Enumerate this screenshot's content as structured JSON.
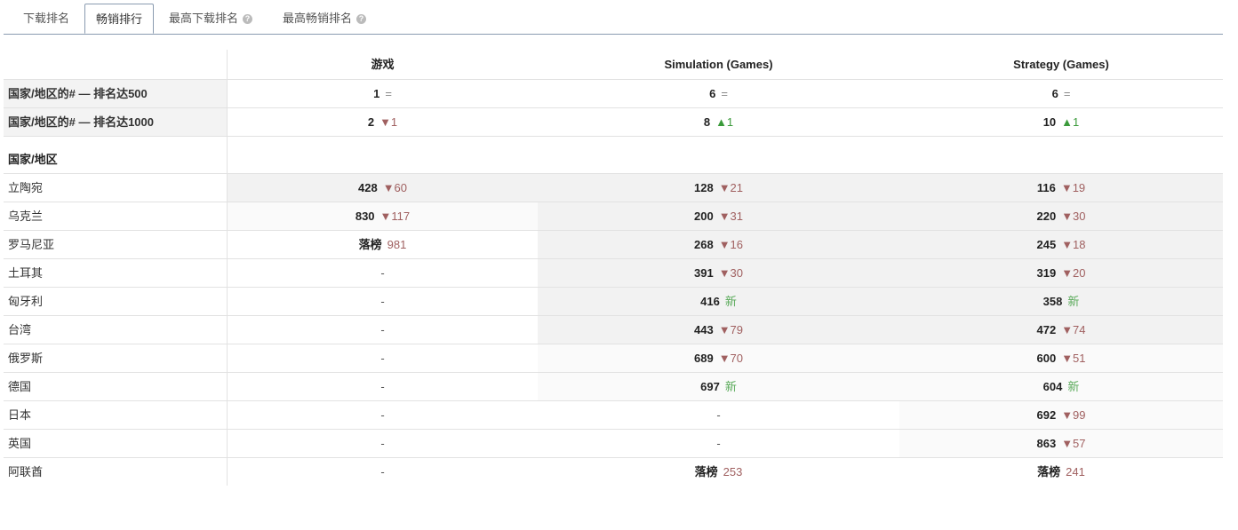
{
  "tabs": [
    {
      "label": "下载排名",
      "active": false,
      "help": false
    },
    {
      "label": "畅销排行",
      "active": true,
      "help": false
    },
    {
      "label": "最高下载排名",
      "active": false,
      "help": true
    },
    {
      "label": "最高畅销排名",
      "active": false,
      "help": true
    }
  ],
  "columns": [
    "游戏",
    "Simulation (Games)",
    "Strategy (Games)"
  ],
  "summary_rows": [
    {
      "label": "国家/地区的# — 排名达500",
      "cells": [
        {
          "num": "1",
          "change": "=",
          "dir": "eq"
        },
        {
          "num": "6",
          "change": "=",
          "dir": "eq"
        },
        {
          "num": "6",
          "change": "=",
          "dir": "eq"
        }
      ]
    },
    {
      "label": "国家/地区的# — 排名达1000",
      "cells": [
        {
          "num": "2",
          "change": "▼1",
          "dir": "down"
        },
        {
          "num": "8",
          "change": "▲1",
          "dir": "up"
        },
        {
          "num": "10",
          "change": "▲1",
          "dir": "up"
        }
      ]
    }
  ],
  "section_label": "国家/地区",
  "countries": [
    {
      "name": "立陶宛",
      "cells": [
        {
          "num": "428",
          "change": "▼60",
          "dir": "down"
        },
        {
          "num": "128",
          "change": "▼21",
          "dir": "down"
        },
        {
          "num": "116",
          "change": "▼19",
          "dir": "down"
        }
      ]
    },
    {
      "name": "乌克兰",
      "cells": [
        {
          "num": "830",
          "change": "▼117",
          "dir": "down"
        },
        {
          "num": "200",
          "change": "▼31",
          "dir": "down"
        },
        {
          "num": "220",
          "change": "▼30",
          "dir": "down"
        }
      ]
    },
    {
      "name": "罗马尼亚",
      "cells": [
        {
          "num": "落榜",
          "change": "981",
          "dir": "dropped"
        },
        {
          "num": "268",
          "change": "▼16",
          "dir": "down"
        },
        {
          "num": "245",
          "change": "▼18",
          "dir": "down"
        }
      ]
    },
    {
      "name": "土耳其",
      "cells": [
        {
          "num": "-",
          "change": "",
          "dir": "dash"
        },
        {
          "num": "391",
          "change": "▼30",
          "dir": "down"
        },
        {
          "num": "319",
          "change": "▼20",
          "dir": "down"
        }
      ]
    },
    {
      "name": "匈牙利",
      "cells": [
        {
          "num": "-",
          "change": "",
          "dir": "dash"
        },
        {
          "num": "416",
          "change": "新",
          "dir": "new"
        },
        {
          "num": "358",
          "change": "新",
          "dir": "new"
        }
      ]
    },
    {
      "name": "台湾",
      "cells": [
        {
          "num": "-",
          "change": "",
          "dir": "dash"
        },
        {
          "num": "443",
          "change": "▼79",
          "dir": "down"
        },
        {
          "num": "472",
          "change": "▼74",
          "dir": "down"
        }
      ]
    },
    {
      "name": "俄罗斯",
      "cells": [
        {
          "num": "-",
          "change": "",
          "dir": "dash"
        },
        {
          "num": "689",
          "change": "▼70",
          "dir": "down"
        },
        {
          "num": "600",
          "change": "▼51",
          "dir": "down"
        }
      ]
    },
    {
      "name": "德国",
      "cells": [
        {
          "num": "-",
          "change": "",
          "dir": "dash"
        },
        {
          "num": "697",
          "change": "新",
          "dir": "new"
        },
        {
          "num": "604",
          "change": "新",
          "dir": "new"
        }
      ]
    },
    {
      "name": "日本",
      "cells": [
        {
          "num": "-",
          "change": "",
          "dir": "dash"
        },
        {
          "num": "-",
          "change": "",
          "dir": "dash"
        },
        {
          "num": "692",
          "change": "▼99",
          "dir": "down"
        }
      ]
    },
    {
      "name": "英国",
      "cells": [
        {
          "num": "-",
          "change": "",
          "dir": "dash"
        },
        {
          "num": "-",
          "change": "",
          "dir": "dash"
        },
        {
          "num": "863",
          "change": "▼57",
          "dir": "down"
        }
      ]
    },
    {
      "name": "阿联酋",
      "cells": [
        {
          "num": "-",
          "change": "",
          "dir": "dash"
        },
        {
          "num": "落榜",
          "change": "253",
          "dir": "dropped"
        },
        {
          "num": "落榜",
          "change": "241",
          "dir": "dropped"
        }
      ]
    }
  ]
}
